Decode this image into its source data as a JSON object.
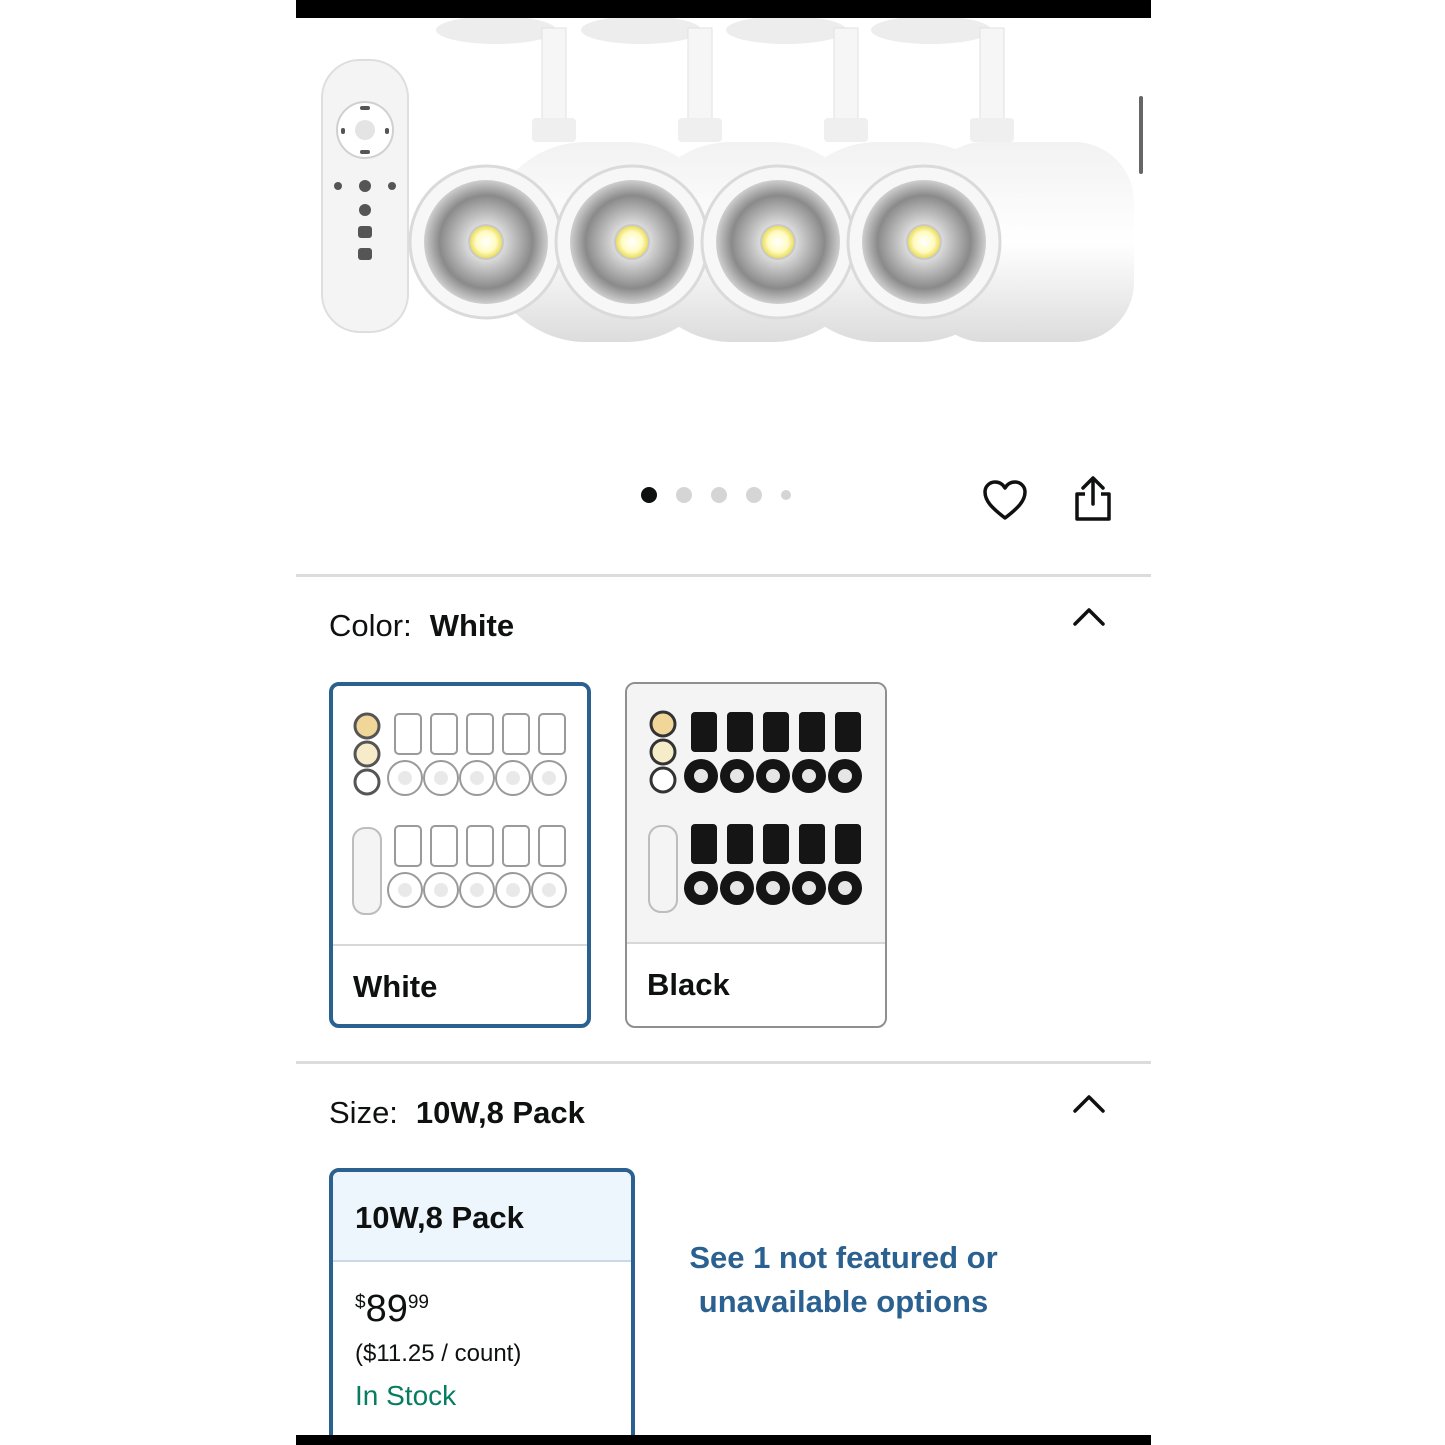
{
  "gallery": {
    "dot_count": 5,
    "active_index": 0
  },
  "color": {
    "label": "Color:",
    "selected_value": "White",
    "options": [
      {
        "name": "White",
        "selected": true
      },
      {
        "name": "Black",
        "selected": false
      }
    ]
  },
  "size": {
    "label": "Size:",
    "selected_value": "10W,8 Pack",
    "option": {
      "name": "10W,8 Pack",
      "price_symbol": "$",
      "price_whole": "89",
      "price_fraction": "99",
      "unit_price": "($11.25 / count)",
      "availability": "In Stock"
    },
    "see_more": "See 1 not featured or unavailable options"
  },
  "colors": {
    "link": "#2a6190",
    "in_stock": "#067d62",
    "selected_border": "#2a6190"
  },
  "icons": [
    "heart-icon",
    "share-icon",
    "chevron-up-icon"
  ]
}
